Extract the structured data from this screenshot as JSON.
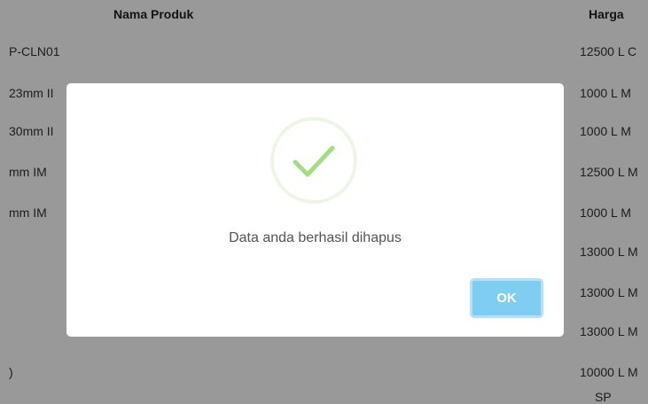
{
  "table": {
    "headers": {
      "name": "Nama Produk",
      "price": "Harga"
    },
    "rows": [
      {
        "name": "P-CLN01",
        "price": "12500 L C"
      },
      {
        "name": "23mm II",
        "price": "1000   L M"
      },
      {
        "name": "30mm II",
        "price": "1000   L M"
      },
      {
        "name": "mm IM",
        "price": "12500 L M"
      },
      {
        "name": "mm IM",
        "price": "1000   L M"
      },
      {
        "name": "",
        "price": "13000 L M"
      },
      {
        "name": "",
        "price": "13000 L M"
      },
      {
        "name": "",
        "price": "13000 L M"
      },
      {
        "name": ")",
        "price": "10000 L M"
      },
      {
        "name": "",
        "price": "SP"
      }
    ]
  },
  "dialog": {
    "message": "Data anda berhasil dihapus",
    "ok_label": "OK",
    "icon": "success-check-icon",
    "icon_color": "#a5dc86",
    "button_color": "#7fcdf1"
  }
}
